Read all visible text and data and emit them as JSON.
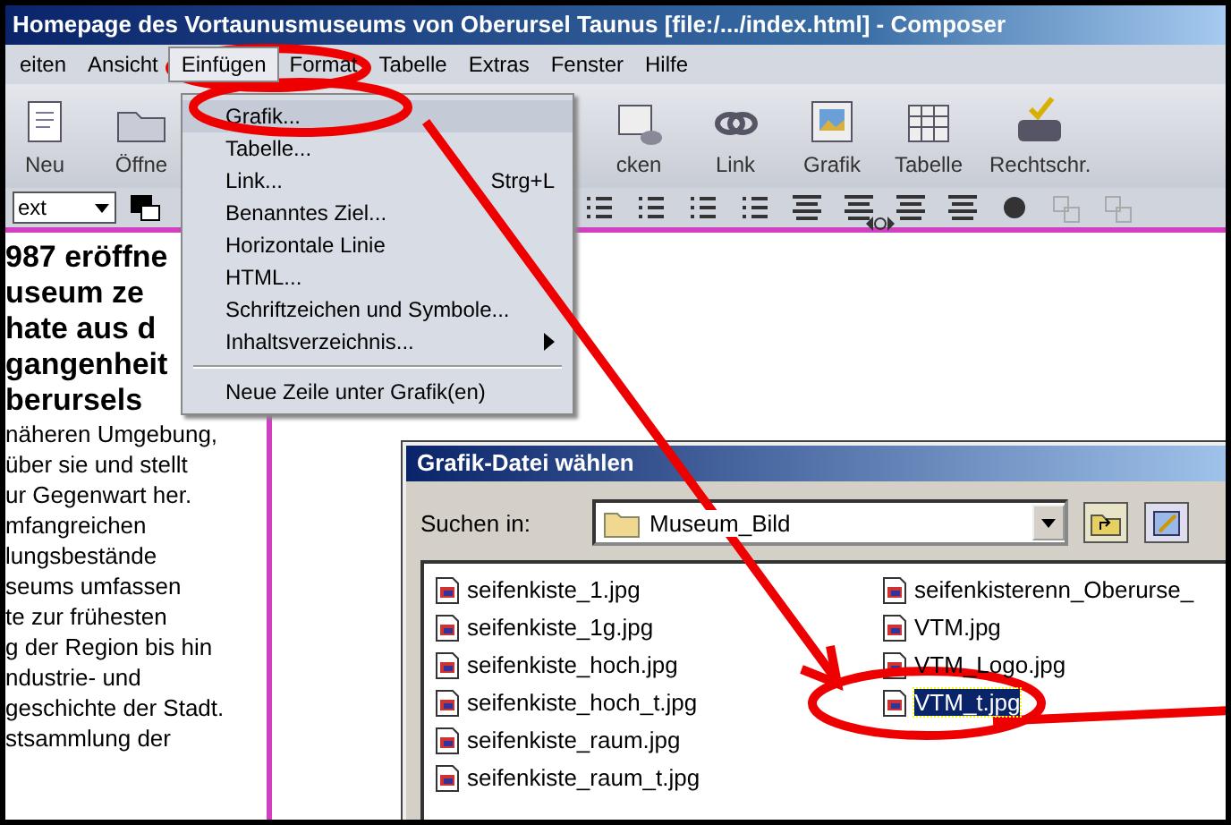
{
  "window": {
    "title": "Homepage des Vortaunusmuseums von Oberursel Taunus [file:/.../index.html] - Composer"
  },
  "menu_bar": [
    {
      "label": "eiten",
      "selected": false
    },
    {
      "label": "Ansicht",
      "selected": false
    },
    {
      "label": "Einfügen",
      "selected": true
    },
    {
      "label": "Format",
      "selected": false
    },
    {
      "label": "Tabelle",
      "selected": false
    },
    {
      "label": "Extras",
      "selected": false
    },
    {
      "label": "Fenster",
      "selected": false
    },
    {
      "label": "Hilfe",
      "selected": false
    }
  ],
  "toolbar": [
    {
      "label": "Neu",
      "kind": "new"
    },
    {
      "label": "Öffne",
      "kind": "open"
    },
    {
      "kind": "gap"
    },
    {
      "label": "cken",
      "kind": "print"
    },
    {
      "label": "Link",
      "kind": "link"
    },
    {
      "label": "Grafik",
      "kind": "image"
    },
    {
      "label": "Tabelle",
      "kind": "table"
    },
    {
      "label": "Rechtschr.",
      "kind": "spell"
    }
  ],
  "format_bar": {
    "style_value": "ext"
  },
  "insert_menu": [
    {
      "kind": "item",
      "label": "Grafik...",
      "selected": true
    },
    {
      "kind": "item",
      "label": "Tabelle...",
      "selected": false
    },
    {
      "kind": "item",
      "label": "Link...",
      "shortcut": "Strg+L",
      "selected": false
    },
    {
      "kind": "item",
      "label": "Benanntes Ziel...",
      "selected": false
    },
    {
      "kind": "item",
      "label": "Horizontale Linie",
      "selected": false
    },
    {
      "kind": "item",
      "label": "HTML...",
      "selected": false
    },
    {
      "kind": "item",
      "label": "Schriftzeichen und Symbole...",
      "selected": false
    },
    {
      "kind": "item",
      "label": "Inhaltsverzeichnis...",
      "submenu": true,
      "selected": false
    },
    {
      "kind": "separator"
    },
    {
      "kind": "item",
      "label": "Neue Zeile unter Grafik(en)",
      "selected": false
    }
  ],
  "editor": {
    "heading_lines": [
      "987 eröffne",
      "useum  ze",
      "hate aus d",
      "gangenheit",
      "berursels"
    ],
    "body_lines": [
      "näheren Umgebung,",
      "über sie und stellt",
      "ur Gegenwart her.",
      "mfangreichen",
      "lungsbestände",
      "seums umfassen",
      "te zur frühesten",
      "g der Region bis hin",
      "ndustrie- und",
      "geschichte der Stadt.",
      "stsammlung der"
    ]
  },
  "file_dialog": {
    "title": "Grafik-Datei wählen",
    "look_in_label": "Suchen in:",
    "look_in_value": "Museum_Bild",
    "files": [
      {
        "name": "seifenkiste_1.jpg",
        "selected": false
      },
      {
        "name": "seifenkiste_1g.jpg",
        "selected": false
      },
      {
        "name": "seifenkiste_hoch.jpg",
        "selected": false
      },
      {
        "name": "seifenkiste_hoch_t.jpg",
        "selected": false
      },
      {
        "name": "seifenkiste_raum.jpg",
        "selected": false
      },
      {
        "name": "seifenkiste_raum_t.jpg",
        "selected": false
      },
      {
        "name": "seifenkisterenn_Oberurse_",
        "selected": false
      },
      {
        "name": "VTM.jpg",
        "selected": false
      },
      {
        "name": "VTM_Logo.jpg",
        "selected": false
      },
      {
        "name": "VTM_t.jpg",
        "selected": true
      }
    ]
  }
}
